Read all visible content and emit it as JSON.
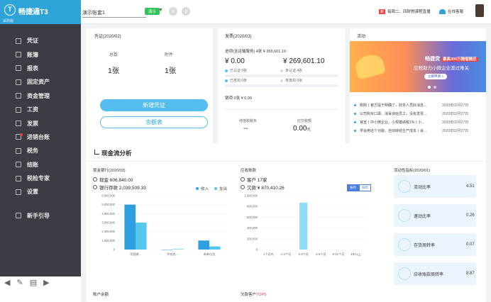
{
  "app": {
    "brand": "畅捷通T3",
    "edition": "采购版",
    "account_name": "演示账套1",
    "env_tag": "演示",
    "notice_tag": "新",
    "notice_text": "每周二、四财税课程直播",
    "online_text": "在线客服"
  },
  "sidebar": {
    "items": [
      {
        "label": "凭证",
        "icon": "voucher-icon"
      },
      {
        "label": "账簿",
        "icon": "ledger-icon"
      },
      {
        "label": "报表",
        "icon": "report-icon"
      },
      {
        "label": "固定资产",
        "icon": "asset-icon"
      },
      {
        "label": "资金管理",
        "icon": "fund-icon"
      },
      {
        "label": "工资",
        "icon": "salary-icon"
      },
      {
        "label": "发票",
        "icon": "invoice-icon"
      },
      {
        "label": "进销台账",
        "icon": "inventory-icon"
      },
      {
        "label": "税务",
        "icon": "tax-icon"
      },
      {
        "label": "结账",
        "icon": "close-period-icon"
      },
      {
        "label": "税检专家",
        "icon": "tax-check-icon"
      },
      {
        "label": "设置",
        "icon": "gear-icon"
      },
      {
        "label": "新手引导",
        "icon": "guide-icon"
      }
    ],
    "tools": [
      "arrow-left-icon",
      "pencil-icon",
      "list-icon",
      "arrow-right-icon"
    ]
  },
  "voucher": {
    "title": "凭证(2020/02)",
    "total_label": "总数",
    "attach_label": "附件",
    "total_value": "1张",
    "attach_value": "1张",
    "add_button": "新增凭证",
    "balance_button": "余额表"
  },
  "invoice": {
    "title": "发票(2020/03)",
    "sales_line": "进项(含运输服务) 4张  ¥ 269,601.10",
    "amount_left": "¥ 0.00",
    "amount_right": "¥ 269,601.10",
    "certified": "已认证  0张",
    "uncertified": "未认证  4张",
    "deducted": "已抵扣  0张",
    "undeducted": "未抵扣  0张",
    "sales": "销项    0张    ¥ 0.00",
    "vat_label": "增值税税负",
    "vat_value": "--",
    "tax_label": "应交税额",
    "tax_value": "0.00",
    "tax_unit": "元"
  },
  "activity": {
    "title": "活动",
    "banner_title": "畅捷贷",
    "banner_highlight": "最高300万随借随还",
    "banner_subtitle": "应税助力小微企业渡过难关",
    "banner_cta": "立即申请 >",
    "news": [
      {
        "text": "刚刚丨官方提于明确了，财务人员好消息...",
        "date": "2020年02月27日"
      },
      {
        "text": "公司购买口罩、消毒液给员工，没有发票...",
        "date": "2020年02月27日"
      },
      {
        "text": "官宣丨中小微企业，小规模纳税1%丨小...",
        "date": "2020年02月27日"
      },
      {
        "text": "学会用这个功能，自动转结生产成本丨会...",
        "date": "2020年02月27日"
      }
    ]
  },
  "cashflow": {
    "title": "现金流分析",
    "bank_title": "现金银行(2020/03)",
    "cash_line": "现金  606,840.00",
    "bank_line": "银行存款  2,039,509.33",
    "legend_in": "收入",
    "legend_out": "支出",
    "receivable_title": "应收账款",
    "customer_line": "客户  17家",
    "owed_line": "欠款  ¥ 870,410.26",
    "toggle_on": "按月",
    "toggle_off": "按年",
    "ratio_title": "流动性指标(2020/01)",
    "ratios": [
      {
        "name": "流动比率",
        "value": "4.51",
        "icon": "liquidity-icon"
      },
      {
        "name": "速动比率",
        "value": "0.26",
        "icon": "rocket-icon"
      },
      {
        "name": "存货周转率",
        "value": "0.07",
        "icon": "inventory-turnover-icon"
      },
      {
        "name": "应收账款周转率",
        "value": "8.87",
        "icon": "receivable-turnover-icon"
      }
    ],
    "account_balance_title": "账户余额",
    "top5_title": "欠款客户",
    "top5_tag": "TOP5"
  },
  "colors": {
    "accent": "#2da3d8",
    "income": "#2d9fe0",
    "expense": "#53c7ee",
    "bar": "#2d9fe0"
  },
  "chart_data": [
    {
      "type": "bar",
      "categories": [
        "华国建...",
        "华农农...",
        "本单位金"
      ],
      "series": [
        {
          "name": "收入",
          "values": [
            5000000,
            0,
            1000000
          ]
        },
        {
          "name": "支出",
          "values": [
            3000000,
            50000,
            350000
          ]
        }
      ],
      "yticks": [
        "6,000,000",
        "5,000,000",
        "4,000,000",
        "3,000,000",
        "2,000,000",
        "1,000,000",
        "0"
      ],
      "ylim": [
        0,
        6000000
      ]
    },
    {
      "type": "bar",
      "categories": [
        "1个月内",
        "1-2个月",
        "2-3个月",
        "3-6个月",
        "6-12个月",
        "1年以上"
      ],
      "values": [
        0,
        0,
        870410,
        0,
        0,
        0
      ],
      "yticks": [
        "1,000,000",
        "800,000",
        "600,000",
        "400,000",
        "200,000",
        "0"
      ],
      "ylim": [
        0,
        1000000
      ]
    }
  ]
}
